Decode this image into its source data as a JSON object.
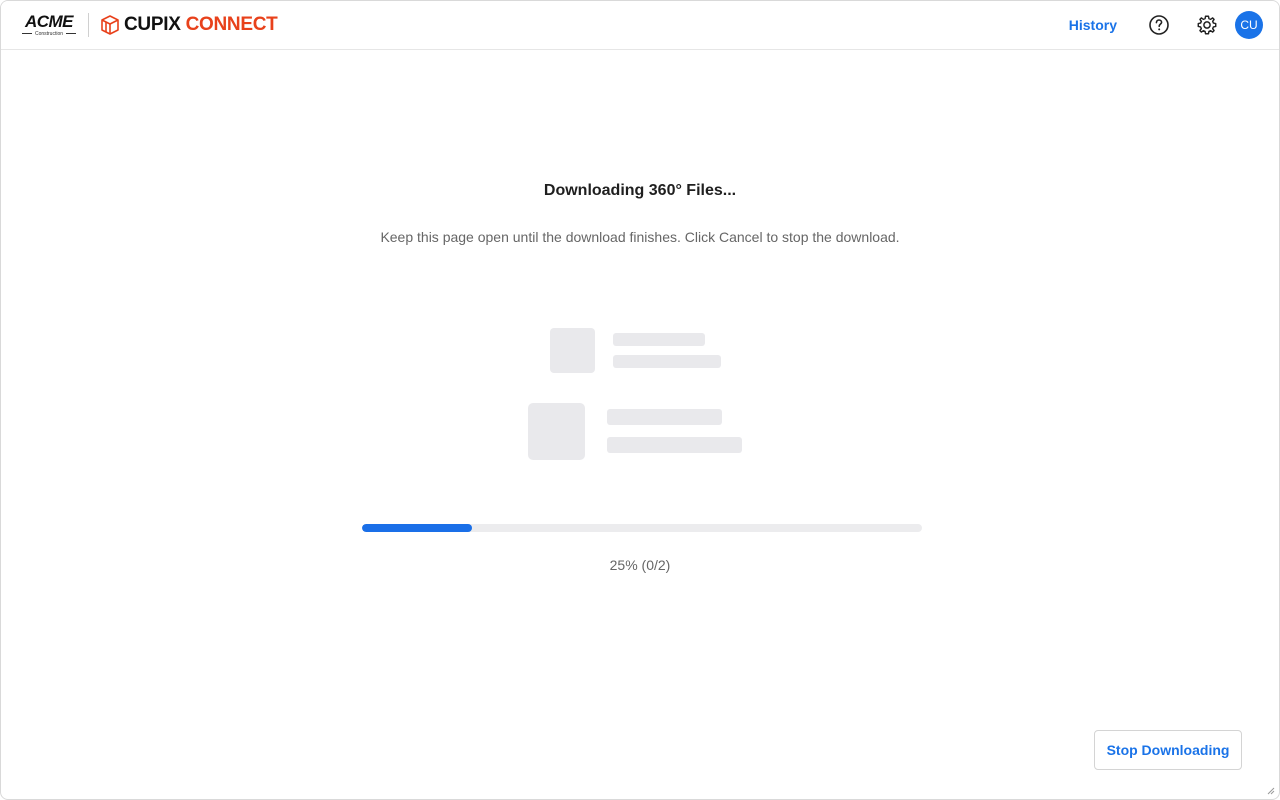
{
  "header": {
    "brand": {
      "acme_word": "ACME",
      "acme_sub": "Construction",
      "cupix_part1": "CUPIX",
      "cupix_part2": "CONNECT",
      "cupix_color": "#e8411b"
    },
    "nav": {
      "history_label": "History",
      "help_icon": "help-circle-icon",
      "settings_icon": "gear-icon",
      "avatar_initials": "CU"
    }
  },
  "main": {
    "title": "Downloading 360° Files...",
    "subtitle": "Keep this page open until the download finishes. Click Cancel to stop the download.",
    "progress": {
      "percent": 25,
      "label": "25% (0/2)"
    },
    "stop_button_label": "Stop Downloading"
  },
  "colors": {
    "accent": "#1a73e8",
    "progress_fill": "#1a6fe8",
    "progress_track": "#ececee"
  }
}
